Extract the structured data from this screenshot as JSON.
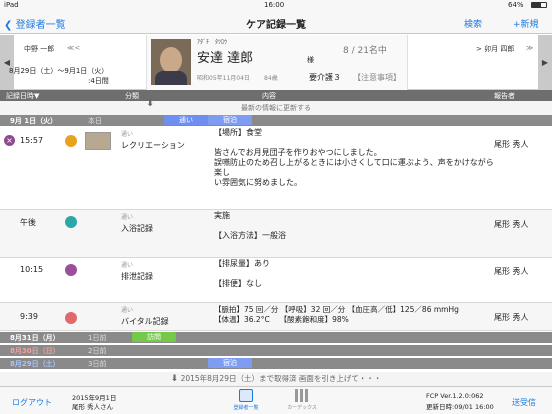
{
  "status": {
    "carrier": "iPad",
    "time": "16:00",
    "battery": "64%"
  },
  "nav": {
    "back_label": "登録者一覧",
    "title": "ケア記録一覧",
    "search": "検索",
    "new": "+新規"
  },
  "patient": {
    "prev_name": "中野 一郎",
    "prev_arrows": "≪<",
    "next_name": "> 卯月 四郎",
    "next_arrows": "≫",
    "date_range": "8月29日（土）～9月1日（火）",
    "date_count": ":4日間",
    "kana": "ｱﾀﾞﾁ　ﾀﾂﾛｳ",
    "name": "安達 達郎",
    "honorific": "様",
    "dob": "昭和05年11月04日",
    "age": "84歳",
    "count": "8 / 21名中",
    "care": "要介護３",
    "notes": "【注意事項】"
  },
  "columns": {
    "datetime": "記録日時▼",
    "category": "分類",
    "content": "内容",
    "reporter": "報告者"
  },
  "update_text": "最新の情報に更新する",
  "day_headers": [
    {
      "date": "9月 1日（火）",
      "rel": "本日",
      "tags": [
        "通い",
        "宿泊"
      ]
    },
    {
      "date": "8月31日（月）",
      "rel": "1日前",
      "tags": [
        "訪問"
      ]
    },
    {
      "date": "8月30日（日）",
      "rel": "2日前",
      "tags": []
    },
    {
      "date": "8月29日（土）",
      "rel": "3日前",
      "tags": [
        "宿泊"
      ]
    }
  ],
  "records": [
    {
      "time": "15:57",
      "type": "通い",
      "category": "レクリエーション",
      "lines": [
        "【場所】食堂",
        "",
        "皆さんでお月見団子を作りおやつにしました。",
        "誤嚥防止のため召し上がるときには小さくして口に運ぶよう、声をかけながら楽し",
        "い雰囲気に努めました。"
      ],
      "reporter": "尾形 秀人",
      "color": "#e8a21c"
    },
    {
      "time": "午後",
      "type": "通い",
      "category": "入浴記録",
      "lines": [
        "実施",
        "",
        "【入浴方法】一般浴"
      ],
      "reporter": "尾形 秀人",
      "color": "#2aa8a8"
    },
    {
      "time": "10:15",
      "type": "通い",
      "category": "排泄記録",
      "lines": [
        "【排尿量】あり",
        "",
        "【排便】なし"
      ],
      "reporter": "尾形 秀人",
      "color": "#9b4f9b"
    },
    {
      "time": "9:39",
      "type": "通い",
      "category": "バイタル記録",
      "lines": [
        "【脈拍】75 回／分 【呼吸】32 回／分 【血圧高／低】125／86 mmHg",
        "【体温】36.2°C　 【酸素飽和度】98%"
      ],
      "reporter": "尾形 秀人",
      "color": "#e06a6a"
    }
  ],
  "bottom_text": "2015年8月29日（土）まで取得済 画面を引き上げて・・・",
  "footer": {
    "logout": "ログアウト",
    "date": "2015年9月1日",
    "user": "尾形 秀人さん",
    "tab1": "登録者一覧",
    "tab2": "カーデックス",
    "version": "FCP Ver.1.2.0:062",
    "updated": "更新日時:09/01 16:00",
    "send": "送受信"
  },
  "colors": {
    "accent": "#1a7ae0",
    "tag_blue": "#6f8ff0",
    "tag_green": "#74c94a",
    "day_gray": "#8a8a8a"
  }
}
